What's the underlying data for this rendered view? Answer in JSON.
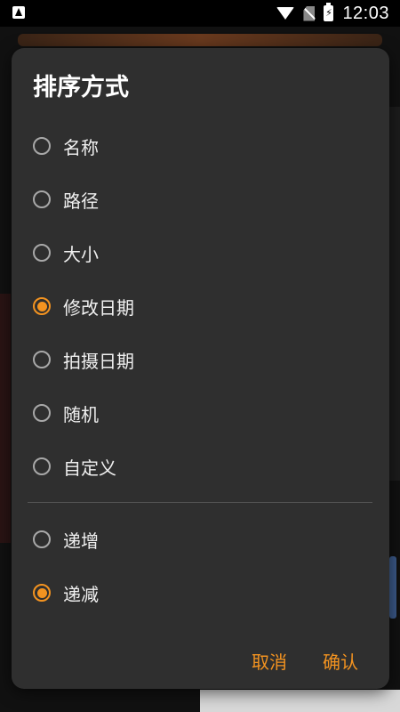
{
  "status_bar": {
    "time": "12:03",
    "icons": [
      "app-icon",
      "wifi-icon",
      "no-sim-icon",
      "battery-charging-icon"
    ]
  },
  "dialog": {
    "title": "排序方式",
    "sort_options": [
      {
        "label": "名称",
        "selected": false
      },
      {
        "label": "路径",
        "selected": false
      },
      {
        "label": "大小",
        "selected": false
      },
      {
        "label": "修改日期",
        "selected": true
      },
      {
        "label": "拍摄日期",
        "selected": false
      },
      {
        "label": "随机",
        "selected": false
      },
      {
        "label": "自定义",
        "selected": false
      }
    ],
    "order_options": [
      {
        "label": "递增",
        "selected": false
      },
      {
        "label": "递减",
        "selected": true
      }
    ],
    "cancel_label": "取消",
    "confirm_label": "确认"
  },
  "colors": {
    "accent": "#f39320",
    "dialog_bg": "#2f2f2f",
    "text": "#f0f0f0"
  }
}
